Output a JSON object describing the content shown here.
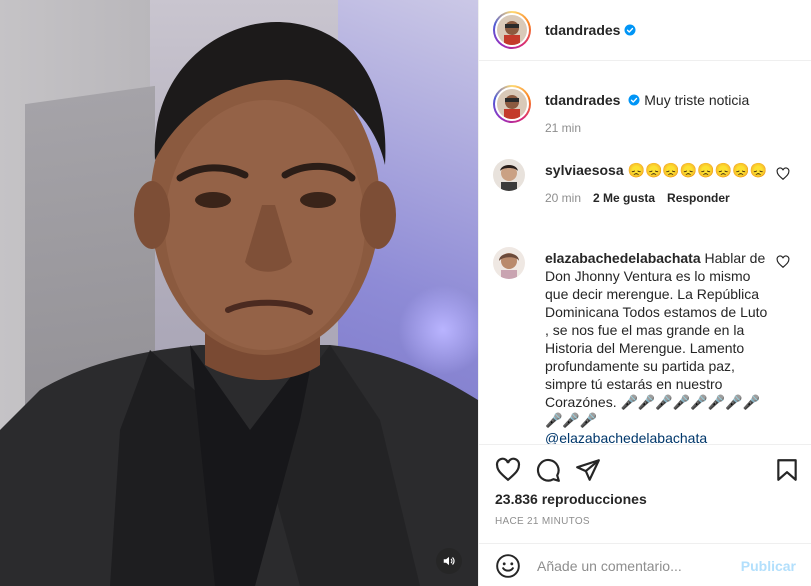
{
  "post": {
    "username": "tdandrades",
    "caption": "Muy triste noticia",
    "caption_time": "21 min"
  },
  "comments": [
    {
      "username": "sylviaesosa",
      "text": "😞😞😞😞😞😞😞😞",
      "time": "20 min",
      "likes": "2 Me gusta",
      "reply_label": "Responder"
    },
    {
      "username": "elazabachedelabachata",
      "text": "Hablar de Don Jhonny Ventura es lo mismo que decir merengue. La República Dominicana Todos estamos de Luto , se nos fue el mas grande en la Historia del Merengue. Lamento profundamente su partida paz, simpre tú estarás en nuestro Corazónes. 🎤🎤🎤🎤🎤🎤🎤🎤🎤🎤🎤",
      "mention": "@elazabachedelabachata"
    }
  ],
  "stats": {
    "views": "23.836 reproducciones",
    "posted_ago": "HACE 21 MINUTOS"
  },
  "comment_box": {
    "placeholder": "Añade un comentario...",
    "publish_label": "Publicar"
  },
  "colors": {
    "verified_blue": "#0095f6",
    "publish_disabled": "#b2dffc",
    "meta_gray": "#8e8e8e"
  }
}
